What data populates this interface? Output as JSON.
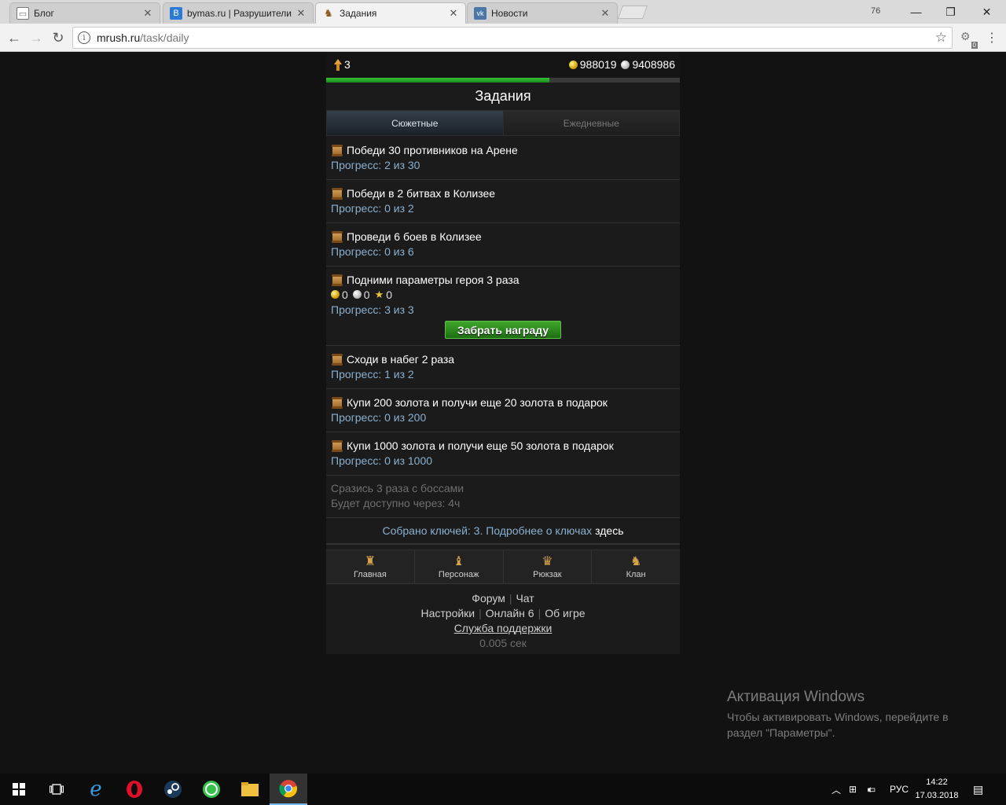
{
  "browser": {
    "tabs": [
      {
        "title": "Блог",
        "favicon": "page-icon"
      },
      {
        "title": "bymas.ru | Разрушители",
        "favicon": "b-icon"
      },
      {
        "title": "Задания",
        "favicon": "game-icon"
      },
      {
        "title": "Новости",
        "favicon": "vk-icon"
      }
    ],
    "url_domain": "mrush.ru",
    "url_path": "/task/daily",
    "user_badge": "76",
    "ext_count": "0"
  },
  "game": {
    "level": "3",
    "gold": "988019",
    "silver": "9408986",
    "xp_fraction": 0.63,
    "title": "Задания",
    "tabs": [
      "Сюжетные",
      "Ежедневные"
    ],
    "tasks": [
      {
        "name": "Победи 30 противников на Арене",
        "progress": "Прогресс: 2 из 30"
      },
      {
        "name": "Победи в 2 битвах в Колизее",
        "progress": "Прогресс: 0 из 2"
      },
      {
        "name": "Проведи 6 боев в Колизее",
        "progress": "Прогресс: 0 из 6"
      },
      {
        "name": "Подними параметры героя 3 раза",
        "reward_gold": "0",
        "reward_silver": "0",
        "reward_star": "0",
        "progress": "Прогресс: 3 из 3",
        "claim": "Забрать награду"
      },
      {
        "name": "Сходи в набег 2 раза",
        "progress": "Прогресс: 1 из 2"
      },
      {
        "name": "Купи 200 золота и получи еще 20 золота в подарок",
        "progress": "Прогресс: 0 из 200"
      },
      {
        "name": "Купи 1000 золота и получи еще 50 золота в подарок",
        "progress": "Прогресс: 0 из 1000"
      }
    ],
    "locked_task": {
      "name": "Сразись 3 раза с боссами",
      "available": "Будет доступно через: 4ч"
    },
    "keys_text": "Собрано ключей: 3. Подробнее о ключах",
    "keys_link": "здесь",
    "nav": [
      "Главная",
      "Персонаж",
      "Рюкзак",
      "Клан"
    ],
    "footer": {
      "forum": "Форум",
      "chat": "Чат",
      "settings": "Настройки",
      "online": "Онлайн 6",
      "about": "Об игре",
      "support": "Служба поддержки",
      "time": "0.005 сек"
    }
  },
  "watermark": {
    "title": "Активация Windows",
    "line1": "Чтобы активировать Windows, перейдите в",
    "line2": "раздел \"Параметры\"."
  },
  "taskbar": {
    "lang": "РУС",
    "time": "14:22",
    "date": "17.03.2018"
  }
}
